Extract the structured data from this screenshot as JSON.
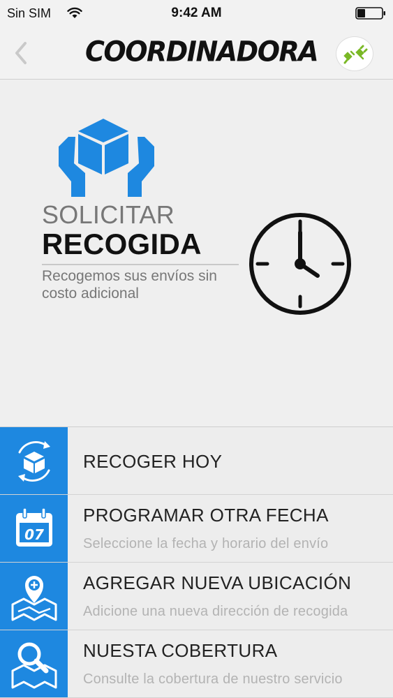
{
  "status_bar": {
    "carrier": "Sin SIM",
    "time": "9:42 AM"
  },
  "nav": {
    "brand": "COORDINADORA"
  },
  "hero": {
    "line1": "SOLICITAR",
    "line2": "RECOGIDA",
    "subtitle": "Recogemos sus envíos sin costo adicional"
  },
  "menu": {
    "items": [
      {
        "title": "RECOGER HOY",
        "subtitle": "",
        "icon": "package-refresh-icon"
      },
      {
        "title": "PROGRAMAR OTRA FECHA",
        "subtitle": "Seleccione la fecha y horario del envío",
        "icon": "calendar-icon"
      },
      {
        "title": "AGREGAR NUEVA UBICACIÓN",
        "subtitle": "Adicione una nueva dirección de recogida",
        "icon": "map-pin-add-icon"
      },
      {
        "title": "NUESTA COBERTURA",
        "subtitle": "Consulte la cobertura de nuestro servicio",
        "icon": "map-search-icon"
      }
    ],
    "calendar_day": "07"
  },
  "colors": {
    "accent_blue": "#1e88e0",
    "plug_green": "#7ab826",
    "background": "#efefef"
  }
}
